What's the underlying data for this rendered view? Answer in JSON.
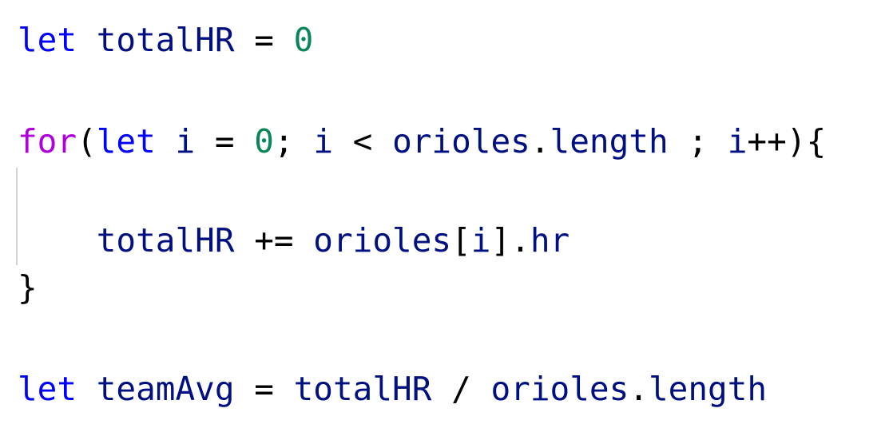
{
  "code": {
    "lines": [
      {
        "tokens": [
          {
            "text": "let",
            "kind": "keyword"
          },
          {
            "text": " ",
            "kind": "space"
          },
          {
            "text": "totalHR",
            "kind": "identifier"
          },
          {
            "text": " = ",
            "kind": "punctuation"
          },
          {
            "text": "0",
            "kind": "number"
          }
        ]
      },
      {
        "tokens": [
          {
            "text": "for",
            "kind": "control"
          },
          {
            "text": "(",
            "kind": "punctuation"
          },
          {
            "text": "let",
            "kind": "keyword"
          },
          {
            "text": " ",
            "kind": "space"
          },
          {
            "text": "i",
            "kind": "identifier"
          },
          {
            "text": " = ",
            "kind": "punctuation"
          },
          {
            "text": "0",
            "kind": "number"
          },
          {
            "text": "; ",
            "kind": "punctuation"
          },
          {
            "text": "i",
            "kind": "identifier"
          },
          {
            "text": " < ",
            "kind": "punctuation"
          },
          {
            "text": "orioles",
            "kind": "identifier"
          },
          {
            "text": ".",
            "kind": "punctuation"
          },
          {
            "text": "length",
            "kind": "identifier"
          },
          {
            "text": " ; ",
            "kind": "punctuation"
          },
          {
            "text": "i",
            "kind": "identifier"
          },
          {
            "text": "++){",
            "kind": "punctuation"
          }
        ]
      },
      {
        "tokens": [
          {
            "text": "    ",
            "kind": "space"
          },
          {
            "text": "totalHR",
            "kind": "identifier"
          },
          {
            "text": " += ",
            "kind": "punctuation"
          },
          {
            "text": "orioles",
            "kind": "identifier"
          },
          {
            "text": "[",
            "kind": "punctuation"
          },
          {
            "text": "i",
            "kind": "identifier"
          },
          {
            "text": "].",
            "kind": "punctuation"
          },
          {
            "text": "hr",
            "kind": "identifier"
          }
        ]
      },
      {
        "tokens": [
          {
            "text": "}",
            "kind": "punctuation"
          }
        ]
      },
      {
        "tokens": [
          {
            "text": "let",
            "kind": "keyword"
          },
          {
            "text": " ",
            "kind": "space"
          },
          {
            "text": "teamAvg",
            "kind": "identifier"
          },
          {
            "text": " = ",
            "kind": "punctuation"
          },
          {
            "text": "totalHR",
            "kind": "identifier"
          },
          {
            "text": " / ",
            "kind": "punctuation"
          },
          {
            "text": "orioles",
            "kind": "identifier"
          },
          {
            "text": ".",
            "kind": "punctuation"
          },
          {
            "text": "length",
            "kind": "identifier"
          }
        ]
      }
    ]
  },
  "colors": {
    "keyword": "#0000ff",
    "control": "#af00db",
    "identifier": "#001080",
    "number": "#098658",
    "punctuation": "#000000",
    "indent_guide": "#d3d3d3",
    "background": "#ffffff"
  }
}
